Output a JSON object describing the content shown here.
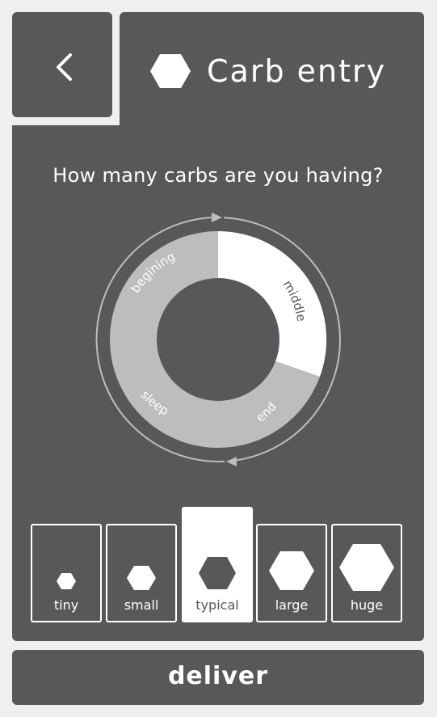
{
  "header": {
    "title": "Carb entry",
    "back_icon": "chevron-left-icon",
    "title_icon": "hexagon-icon"
  },
  "question": "How many carbs are you having?",
  "meal_wheel": {
    "segments": [
      {
        "label": "begining",
        "state": "inactive"
      },
      {
        "label": "middle",
        "state": "active"
      },
      {
        "label": "end",
        "state": "inactive"
      },
      {
        "label": "sleep",
        "state": "inactive"
      }
    ]
  },
  "sizes": [
    {
      "label": "tiny",
      "selected": false
    },
    {
      "label": "small",
      "selected": false
    },
    {
      "label": "typical",
      "selected": true
    },
    {
      "label": "large",
      "selected": false
    },
    {
      "label": "huge",
      "selected": false
    }
  ],
  "deliver_label": "deliver",
  "colors": {
    "background": "#efefef",
    "panel": "#58585a",
    "segment_inactive": "#bdbdbe",
    "segment_active": "#ffffff",
    "text": "#ffffff"
  }
}
